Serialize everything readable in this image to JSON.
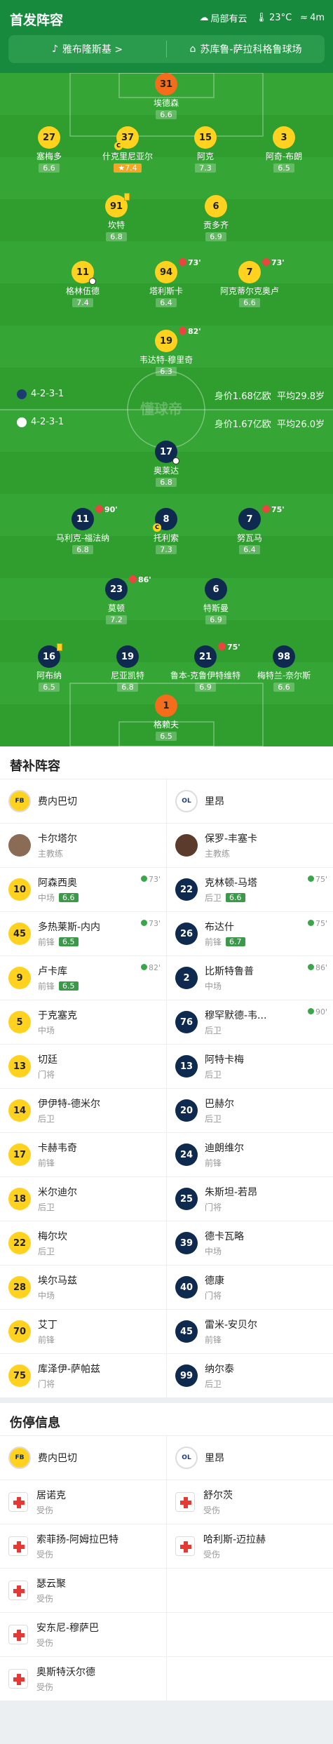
{
  "header": {
    "title": "首发阵容",
    "weather": "局部有云",
    "temp": "23°C",
    "wind": "4m",
    "referee": "雅布隆斯基 >",
    "stadium": "苏库鲁-萨拉科格鲁球场"
  },
  "formations": {
    "home": {
      "formation": "4-2-3-1",
      "value": "身价1.68亿欧",
      "age": "平均29.8岁"
    },
    "away": {
      "formation": "4-2-3-1",
      "value": "身价1.67亿欧",
      "age": "平均26.0岁"
    }
  },
  "watermark": "懂球帝",
  "home_pitch": [
    {
      "num": "31",
      "name": "埃德森",
      "rating": "6.6"
    },
    {
      "num": "27",
      "name": "塞梅多",
      "rating": "6.6"
    },
    {
      "num": "37",
      "name": "什克里尼亚尔",
      "rating": "7.4"
    },
    {
      "num": "15",
      "name": "阿克",
      "rating": "7.3"
    },
    {
      "num": "3",
      "name": "阿奇-布朗",
      "rating": "6.5"
    },
    {
      "num": "91",
      "name": "坎特",
      "rating": "6.8"
    },
    {
      "num": "6",
      "name": "贡多齐",
      "rating": "6.9"
    },
    {
      "num": "11",
      "name": "格林伍德",
      "rating": "7.4"
    },
    {
      "num": "94",
      "name": "塔利斯卡",
      "rating": "6.4",
      "ev": "73'"
    },
    {
      "num": "7",
      "name": "阿克蒂尔克奥卢",
      "rating": "6.6",
      "ev": "73'"
    },
    {
      "num": "19",
      "name": "韦达特-穆里奇",
      "rating": "6.3",
      "ev": "82'"
    }
  ],
  "away_pitch": [
    {
      "num": "17",
      "name": "奥莱达",
      "rating": "6.8"
    },
    {
      "num": "11",
      "name": "马利克-福法纳",
      "rating": "6.8",
      "ev": "90'"
    },
    {
      "num": "8",
      "name": "托利索",
      "rating": "7.3"
    },
    {
      "num": "7",
      "name": "努瓦马",
      "rating": "6.4",
      "ev": "75'"
    },
    {
      "num": "23",
      "name": "莫顿",
      "rating": "7.2",
      "ev": "86'"
    },
    {
      "num": "6",
      "name": "特斯曼",
      "rating": "6.9"
    },
    {
      "num": "16",
      "name": "阿布纳",
      "rating": "6.5"
    },
    {
      "num": "19",
      "name": "尼亚凯特",
      "rating": "6.8"
    },
    {
      "num": "21",
      "name": "鲁本-克鲁伊特维特",
      "rating": "6.9",
      "ev": "75'"
    },
    {
      "num": "98",
      "name": "梅特兰-奈尔斯",
      "rating": "6.6"
    },
    {
      "num": "1",
      "name": "格赖夫",
      "rating": "6.5"
    }
  ],
  "subs_title": "替补阵容",
  "teams": {
    "home": "费内巴切",
    "away": "里昂",
    "home_crest": "FB",
    "away_crest": "OL"
  },
  "coaches": {
    "home": {
      "name": "卡尔塔尔",
      "role": "主教练"
    },
    "away": {
      "name": "保罗-丰塞卡",
      "role": "主教练"
    }
  },
  "subs_home": [
    {
      "num": "10",
      "name": "阿森西奥",
      "pos": "中场",
      "rating": "6.6",
      "time": "73'"
    },
    {
      "num": "45",
      "name": "多热莱斯-内内",
      "pos": "前锋",
      "rating": "6.5",
      "time": "73'"
    },
    {
      "num": "9",
      "name": "卢卡库",
      "pos": "前锋",
      "rating": "6.5",
      "time": "82'"
    },
    {
      "num": "5",
      "name": "于克塞克",
      "pos": "中场"
    },
    {
      "num": "13",
      "name": "切廷",
      "pos": "门将"
    },
    {
      "num": "14",
      "name": "伊伊特-德米尔",
      "pos": "后卫"
    },
    {
      "num": "17",
      "name": "卡赫韦奇",
      "pos": "前锋"
    },
    {
      "num": "18",
      "name": "米尔迪尔",
      "pos": "后卫"
    },
    {
      "num": "22",
      "name": "梅尔坎",
      "pos": "后卫"
    },
    {
      "num": "28",
      "name": "埃尔马兹",
      "pos": "中场"
    },
    {
      "num": "70",
      "name": "艾丁",
      "pos": "前锋"
    },
    {
      "num": "75",
      "name": "库泽伊-萨帕兹",
      "pos": "门将"
    }
  ],
  "subs_away": [
    {
      "num": "22",
      "name": "克林顿-马塔",
      "pos": "后卫",
      "rating": "6.6",
      "time": "75'"
    },
    {
      "num": "26",
      "name": "布达什",
      "pos": "前锋",
      "rating": "6.7",
      "time": "75'"
    },
    {
      "num": "2",
      "name": "比斯特鲁普",
      "pos": "中场",
      "time": "86'"
    },
    {
      "num": "76",
      "name": "穆罕默德-韦...",
      "pos": "后卫",
      "time": "90'"
    },
    {
      "num": "13",
      "name": "阿特卡梅",
      "pos": "后卫"
    },
    {
      "num": "20",
      "name": "巴赫尔",
      "pos": "后卫"
    },
    {
      "num": "24",
      "name": "迪朗维尔",
      "pos": "前锋"
    },
    {
      "num": "25",
      "name": "朱斯坦-若昂",
      "pos": "门将"
    },
    {
      "num": "39",
      "name": "德卡瓦略",
      "pos": "中场"
    },
    {
      "num": "40",
      "name": "德康",
      "pos": "门将"
    },
    {
      "num": "45",
      "name": "雷米-安贝尔",
      "pos": "前锋"
    },
    {
      "num": "99",
      "name": "纳尔泰",
      "pos": "后卫"
    }
  ],
  "injury_title": "伤停信息",
  "injuries_home": [
    {
      "name": "居诺克",
      "status": "受伤"
    },
    {
      "name": "索菲扬-阿姆拉巴特",
      "status": "受伤"
    },
    {
      "name": "瑟云聚",
      "status": "受伤"
    },
    {
      "name": "安东尼-穆萨巴",
      "status": "受伤"
    },
    {
      "name": "奥斯特沃尔德",
      "status": "受伤"
    }
  ],
  "injuries_away": [
    {
      "name": "舒尔茨",
      "status": "受伤"
    },
    {
      "name": "哈利斯-迈拉赫",
      "status": "受伤"
    }
  ]
}
